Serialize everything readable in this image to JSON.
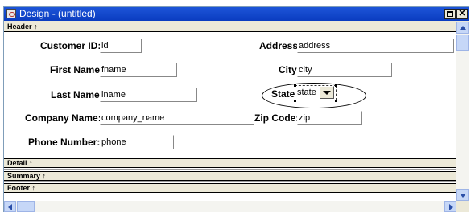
{
  "window": {
    "title": "Design - (untitled)",
    "min_label": "_",
    "close_label": "✕"
  },
  "bands": {
    "header": "Header ↑",
    "detail": "Detail ↑",
    "summary": "Summary ↑",
    "footer": "Footer ↑"
  },
  "form": {
    "customer_id": {
      "label": "Customer ID:",
      "value": "id"
    },
    "first_name": {
      "label": "First Name:",
      "value": "fname"
    },
    "last_name": {
      "label": "Last Name:",
      "value": "lname"
    },
    "company_name": {
      "label": "Company Name:",
      "value": "company_name"
    },
    "phone": {
      "label": "Phone Number:",
      "value": "phone"
    },
    "address": {
      "label": "Address:",
      "value": "address"
    },
    "city": {
      "label": "City:",
      "value": "city"
    },
    "state": {
      "label": "State:",
      "value": "state"
    },
    "zip": {
      "label": "Zip Code:",
      "value": "zip"
    }
  },
  "icons": [
    "app-icon",
    "minimize-icon",
    "maximize-icon",
    "close-icon",
    "scroll-up-icon",
    "scroll-down-icon",
    "scroll-left-icon",
    "scroll-right-icon",
    "dropdown-arrow-icon"
  ],
  "colors": {
    "title_bar": "#0a3cc0",
    "band": "#ece9d8",
    "scrollbar_button": "#c6d7f7"
  }
}
